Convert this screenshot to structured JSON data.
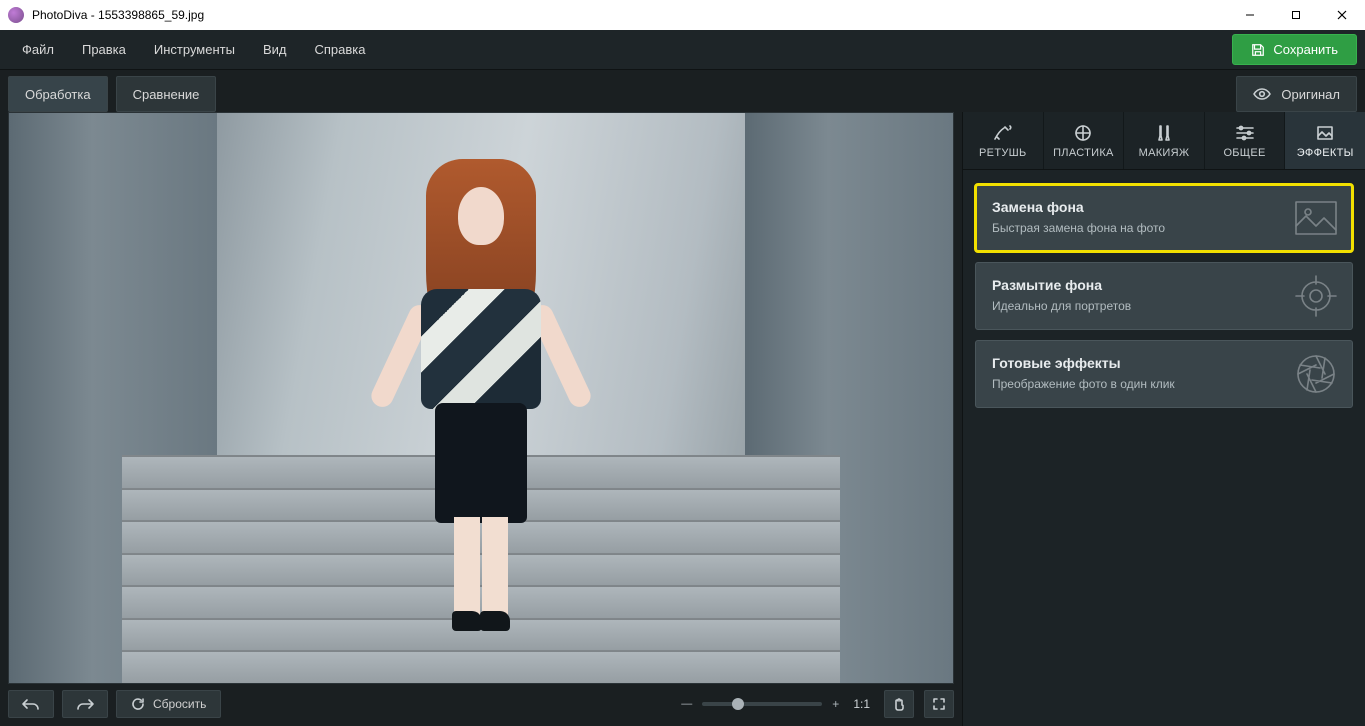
{
  "window": {
    "app_name": "PhotoDiva",
    "document": "1553398865_59.jpg",
    "title": "PhotoDiva - 1553398865_59.jpg"
  },
  "menu": {
    "items": [
      "Файл",
      "Правка",
      "Инструменты",
      "Вид",
      "Справка"
    ],
    "save": "Сохранить"
  },
  "toolbar": {
    "edit_tab": "Обработка",
    "compare_tab": "Сравнение",
    "original": "Оригинал"
  },
  "bottom": {
    "reset": "Сбросить",
    "ratio": "1:1",
    "plus": "+"
  },
  "panel": {
    "tabs": [
      "РЕТУШЬ",
      "ПЛАСТИКА",
      "МАКИЯЖ",
      "ОБЩЕЕ",
      "ЭФФЕКТЫ"
    ],
    "active_tab_index": 4,
    "cards": [
      {
        "title": "Замена фона",
        "sub": "Быстрая замена фона на фото",
        "highlight": true,
        "icon": "background-replace-icon"
      },
      {
        "title": "Размытие фона",
        "sub": "Идеально для портретов",
        "highlight": false,
        "icon": "blur-icon"
      },
      {
        "title": "Готовые эффекты",
        "sub": "Преображение фото в один клик",
        "highlight": false,
        "icon": "aperture-icon"
      }
    ]
  }
}
